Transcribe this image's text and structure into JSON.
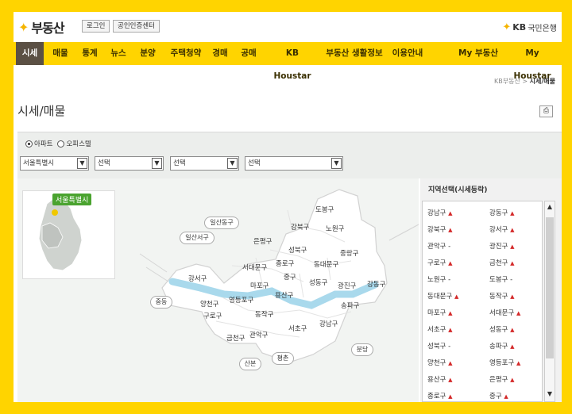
{
  "header": {
    "logo_text": "부동산",
    "login": "로그인",
    "cert_center": "공인인증센터",
    "kb_bold": "KB",
    "kb_rest": "국민은행"
  },
  "nav": [
    "시세",
    "매물",
    "통계",
    "뉴스",
    "분양",
    "주택청약",
    "경매",
    "공매",
    "KB Houstar",
    "부동산 생활정보",
    "이용안내",
    "My 부동산",
    "My Houstar"
  ],
  "breadcrumb": {
    "home": "KB부동산",
    "sep": ">",
    "current": "시세/매물"
  },
  "page_title": "시세/매물",
  "filter": {
    "radios": [
      "아파트",
      "오피스텔"
    ],
    "selects": [
      "서울특별시",
      "선택",
      "선택",
      "선택"
    ]
  },
  "map": {
    "inset_label": "서울특별시",
    "districts": [
      "도봉구",
      "노원구",
      "강북구",
      "은평구",
      "성북구",
      "중랑구",
      "종로구",
      "동대문구",
      "서대문구",
      "중구",
      "마포구",
      "성동구",
      "광진구",
      "강동구",
      "강서구",
      "용산구",
      "영등포구",
      "양천구",
      "구로구",
      "동작구",
      "서초구",
      "강남구",
      "송파구",
      "금천구",
      "관악구"
    ],
    "ovals": [
      "일산동구",
      "일산서구",
      "중동",
      "산본",
      "평촌",
      "분당"
    ]
  },
  "side": {
    "title": "지역선택(시세등락)",
    "items": [
      {
        "name": "강남구",
        "trend": "▲"
      },
      {
        "name": "강동구",
        "trend": "▲"
      },
      {
        "name": "강북구",
        "trend": "▲"
      },
      {
        "name": "강서구",
        "trend": "▲"
      },
      {
        "name": "관악구",
        "trend": "-"
      },
      {
        "name": "광진구",
        "trend": "▲"
      },
      {
        "name": "구로구",
        "trend": "▲"
      },
      {
        "name": "금천구",
        "trend": "▲"
      },
      {
        "name": "노원구",
        "trend": "-"
      },
      {
        "name": "도봉구",
        "trend": "-"
      },
      {
        "name": "동대문구",
        "trend": "▲"
      },
      {
        "name": "동작구",
        "trend": "▲"
      },
      {
        "name": "마포구",
        "trend": "▲"
      },
      {
        "name": "서대문구",
        "trend": "▲"
      },
      {
        "name": "서초구",
        "trend": "▲"
      },
      {
        "name": "성동구",
        "trend": "▲"
      },
      {
        "name": "성북구",
        "trend": "-"
      },
      {
        "name": "송파구",
        "trend": "▲"
      },
      {
        "name": "양천구",
        "trend": "▲"
      },
      {
        "name": "영등포구",
        "trend": "▲"
      },
      {
        "name": "용산구",
        "trend": "▲"
      },
      {
        "name": "은평구",
        "trend": "▲"
      },
      {
        "name": "종로구",
        "trend": "▲"
      },
      {
        "name": "중구",
        "trend": "▲"
      }
    ]
  },
  "colors": {
    "brand_yellow": "#ffd400",
    "nav_active": "#5b5044",
    "river": "#a9d9ec",
    "up_red": "#d42a2a",
    "inset_green": "#4aa32f"
  }
}
